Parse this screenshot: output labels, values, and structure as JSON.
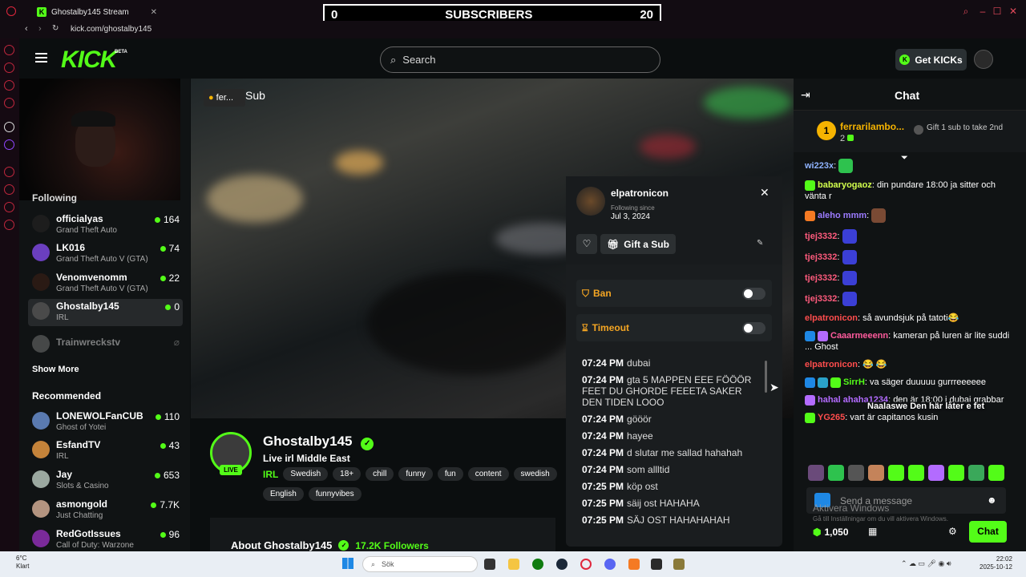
{
  "browser": {
    "tab_title": "Ghostalby145 Stream",
    "url": "kick.com/ghostalby145"
  },
  "overlay": {
    "left_count": "0",
    "label": "SUBSCRIBERS",
    "right_count": "20"
  },
  "header": {
    "logo": "KICK",
    "beta": "BETA",
    "search_placeholder": "Search",
    "get_kicks": "Get KICKs"
  },
  "sidebar": {
    "following_label": "Following",
    "following": [
      {
        "name": "officialyas",
        "game": "Grand Theft Auto",
        "viewers": "164"
      },
      {
        "name": "LK016",
        "game": "Grand Theft Auto V (GTA)",
        "viewers": "74"
      },
      {
        "name": "Venomvenomm",
        "game": "Grand Theft Auto V (GTA)",
        "viewers": "22"
      },
      {
        "name": "Ghostalby145",
        "game": "IRL",
        "viewers": "0"
      },
      {
        "name": "Trainwreckstv",
        "game": "",
        "viewers": ""
      }
    ],
    "show_more": "Show More",
    "recommended_label": "Recommended",
    "recommended": [
      {
        "name": "LONEWOLFanCUB",
        "game": "Ghost of Yotei",
        "viewers": "110"
      },
      {
        "name": "EsfandTV",
        "game": "IRL",
        "viewers": "43"
      },
      {
        "name": "Jay",
        "game": "Slots & Casino",
        "viewers": "653"
      },
      {
        "name": "asmongold",
        "game": "Just Chatting",
        "viewers": "7.7K"
      },
      {
        "name": "RedGotIssues",
        "game": "Call of Duty: Warzone",
        "viewers": "96"
      }
    ]
  },
  "video": {
    "tag": "fer...",
    "sub_text": "Sub"
  },
  "stream": {
    "name": "Ghostalby145",
    "title": "Live irl Middle East",
    "live": "LIVE",
    "category": "IRL",
    "tags1": [
      "Swedish",
      "18+",
      "chill",
      "funny",
      "fun",
      "content",
      "swedish"
    ],
    "tags2": [
      "English",
      "funnyvibes"
    ],
    "about": "About Ghostalby145",
    "followers": "17.2K Followers"
  },
  "popup": {
    "username": "elpatronicon",
    "following_since_label": "Following since",
    "following_since": "Jul 3, 2024",
    "gift_label": "Gift a Sub",
    "ban_label": "Ban",
    "timeout_label": "Timeout",
    "log": [
      {
        "time": "07:24 PM",
        "text": "dubai"
      },
      {
        "time": "07:24 PM",
        "text": "gta 5 MAPPEN EEE FÖÖÖR FEET DU GHORDE FEEETA SAKER DEN TIDEN LOOO"
      },
      {
        "time": "07:24 PM",
        "text": "gööör"
      },
      {
        "time": "07:24 PM",
        "text": "hayee"
      },
      {
        "time": "07:24 PM",
        "text": "d slutar me sallad hahahah"
      },
      {
        "time": "07:24 PM",
        "text": "som allltid"
      },
      {
        "time": "07:25 PM",
        "text": "köp ost"
      },
      {
        "time": "07:25 PM",
        "text": "säij ost HAHAHA"
      },
      {
        "time": "07:25 PM",
        "text": "SÄJ OST HAHAHAHAH"
      }
    ]
  },
  "chat": {
    "title": "Chat",
    "leader_rank": "1",
    "leader_name": "ferrarilambo...",
    "leader_count": "2",
    "leader_gift": "Gift 1 sub to take 2nd",
    "messages": [
      {
        "user": "wi223x",
        "color": "#8fb3ff",
        "text": ""
      },
      {
        "user": "babaryogaoz",
        "color": "#d2ff4d",
        "text": "din pundare 18:00 ja sitter och vänta r"
      },
      {
        "user": "aleho mmm",
        "color": "#9c7bff",
        "text": ""
      },
      {
        "user": "tjej3332",
        "color": "#ff5b7d",
        "text": ""
      },
      {
        "user": "tjej3332",
        "color": "#ff5b7d",
        "text": ""
      },
      {
        "user": "tjej3332",
        "color": "#ff5b7d",
        "text": ""
      },
      {
        "user": "tjej3332",
        "color": "#ff5b7d",
        "text": ""
      },
      {
        "user": "elpatronicon",
        "color": "#ff4d4d",
        "text": "så avundsjuk på tatoti😂"
      },
      {
        "user": "Caaarmeeenn",
        "color": "#ff5b9d",
        "text": "kameran på luren är lite suddi ... Ghost"
      },
      {
        "user": "elpatronicon",
        "color": "#ff4d4d",
        "text": "😂 😂"
      },
      {
        "user": "SirrH",
        "color": "#53fc18",
        "text": "va säger duuuuu gurrreeeeee"
      },
      {
        "user": "hahal ahaha1234",
        "color": "#b36bff",
        "text": "den är 18:00 i dubai grabbar"
      },
      {
        "user": "YG265",
        "color": "#ff4d4d",
        "text": "vart är capitanos kusin"
      }
    ],
    "overlay_text": "Naalaswe  Den här låter e fet",
    "input_placeholder": "Send a message",
    "watermark_title": "Aktivera Windows",
    "watermark_sub": "Gå till Inställningar om du vill aktivera Windows.",
    "points": "1,050",
    "send_label": "Chat"
  },
  "taskbar": {
    "temp": "6°C",
    "weather": "Klart",
    "search": "Sök",
    "time": "22:02",
    "date": "2025-10-12"
  }
}
